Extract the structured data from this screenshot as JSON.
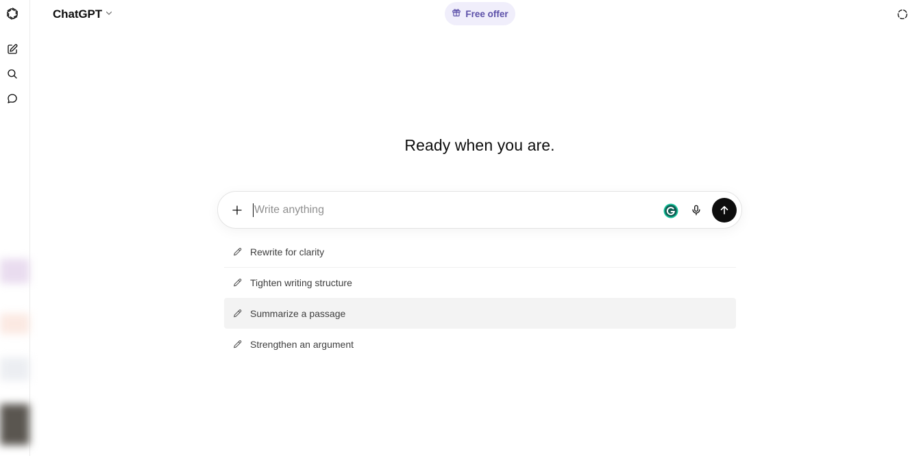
{
  "header": {
    "model_name": "ChatGPT",
    "promo_label": "Free offer"
  },
  "main": {
    "headline": "Ready when you are."
  },
  "composer": {
    "placeholder": "Write anything",
    "value": ""
  },
  "suggestions": [
    {
      "label": "Rewrite for clarity",
      "icon": "pencil-icon"
    },
    {
      "label": "Tighten writing structure",
      "icon": "pencil-icon"
    },
    {
      "label": "Summarize a passage",
      "icon": "pencil-icon"
    },
    {
      "label": "Strengthen an argument",
      "icon": "pencil-icon"
    }
  ],
  "icons": {
    "logo": "openai-logo-icon",
    "rail": [
      "new-chat-icon",
      "search-icon",
      "chat-bubble-icon"
    ],
    "header_right": "temporary-chat-icon",
    "composer": [
      "plus-icon",
      "grammarly-icon",
      "microphone-icon",
      "arrow-up-icon"
    ]
  },
  "colors": {
    "accent_text": "#5b4fa8",
    "promo_bg": "#f0eefb",
    "send_button": "#0d0d0d",
    "grammarly": "#15c39a"
  }
}
